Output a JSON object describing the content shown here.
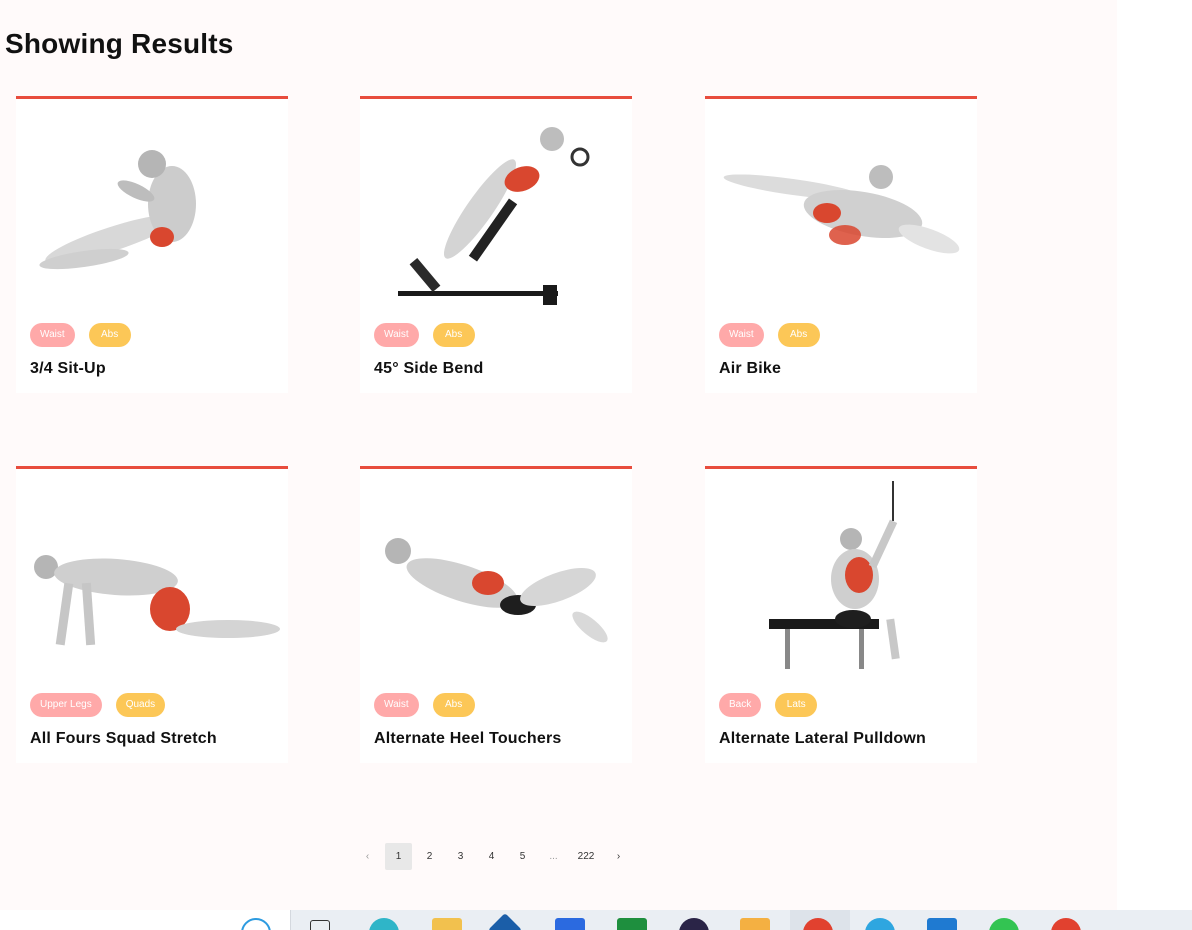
{
  "heading": "Showing Results",
  "exercises": [
    {
      "name": "3/4 Sit-Up",
      "tags": [
        "Waist",
        "Abs"
      ]
    },
    {
      "name": "45° Side Bend",
      "tags": [
        "Waist",
        "Abs"
      ]
    },
    {
      "name": "Air Bike",
      "tags": [
        "Waist",
        "Abs"
      ]
    },
    {
      "name": "All Fours Squad Stretch",
      "tags": [
        "Upper Legs",
        "Quads"
      ]
    },
    {
      "name": "Alternate Heel Touchers",
      "tags": [
        "Waist",
        "Abs"
      ]
    },
    {
      "name": "Alternate Lateral Pulldown",
      "tags": [
        "Back",
        "Lats"
      ]
    }
  ],
  "pagination": {
    "prev": "‹",
    "pages": [
      "1",
      "2",
      "3",
      "4",
      "5"
    ],
    "ellipsis": "...",
    "last": "222",
    "next": "›",
    "current": "1"
  },
  "colors": {
    "accent": "#e84c3d",
    "badge_primary": "#ffa9a9",
    "badge_secondary": "#fcc757",
    "muscle_highlight": "#d9472f"
  }
}
